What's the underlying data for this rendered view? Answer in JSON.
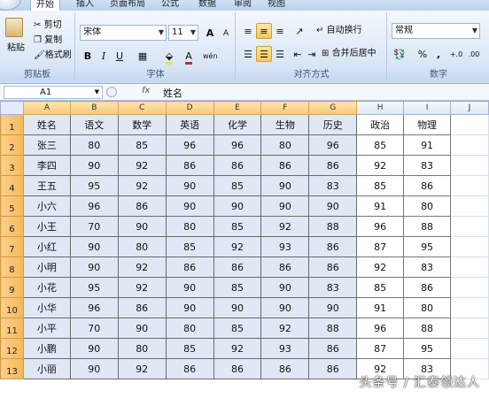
{
  "tabs": [
    "开始",
    "插入",
    "页面布局",
    "公式",
    "数据",
    "审阅",
    "视图"
  ],
  "clipboard": {
    "paste": "粘贴",
    "cut": "剪切",
    "copy": "复制",
    "format_painter": "格式刷",
    "label": "剪贴板"
  },
  "font": {
    "name": "宋体",
    "size": "11",
    "grow": "A",
    "shrink": "A",
    "label": "字体",
    "bold": "B",
    "italic": "I",
    "underline": "U",
    "phonetic": "wén"
  },
  "alignment": {
    "wrap": "自动换行",
    "merge": "合并后居中",
    "label": "对齐方式"
  },
  "number": {
    "format": "常规",
    "percent": "%",
    "comma": ",",
    "label": "数字"
  },
  "formula_bar": {
    "name_box": "A1",
    "fx": "fx",
    "value": "姓名"
  },
  "columns": [
    "A",
    "B",
    "C",
    "D",
    "E",
    "F",
    "G",
    "H",
    "I",
    "J"
  ],
  "rows": [
    [
      "姓名",
      "语文",
      "数学",
      "英语",
      "化学",
      "生物",
      "历史",
      "政治",
      "物理"
    ],
    [
      "张三",
      "80",
      "85",
      "96",
      "96",
      "80",
      "96",
      "85",
      "91"
    ],
    [
      "李四",
      "90",
      "92",
      "86",
      "86",
      "86",
      "86",
      "92",
      "83"
    ],
    [
      "王五",
      "95",
      "92",
      "90",
      "85",
      "90",
      "83",
      "85",
      "86"
    ],
    [
      "小六",
      "96",
      "86",
      "90",
      "90",
      "90",
      "90",
      "91",
      "80"
    ],
    [
      "小王",
      "70",
      "90",
      "80",
      "85",
      "92",
      "88",
      "96",
      "88"
    ],
    [
      "小红",
      "90",
      "80",
      "85",
      "92",
      "93",
      "86",
      "87",
      "95"
    ],
    [
      "小明",
      "90",
      "92",
      "86",
      "86",
      "86",
      "86",
      "92",
      "83"
    ],
    [
      "小花",
      "95",
      "92",
      "90",
      "85",
      "90",
      "83",
      "85",
      "86"
    ],
    [
      "小华",
      "96",
      "86",
      "90",
      "90",
      "90",
      "90",
      "91",
      "80"
    ],
    [
      "小平",
      "70",
      "90",
      "80",
      "85",
      "92",
      "88",
      "96",
      "88"
    ],
    [
      "小鹏",
      "90",
      "80",
      "85",
      "92",
      "93",
      "86",
      "87",
      "95"
    ],
    [
      "小丽",
      "90",
      "92",
      "86",
      "86",
      "86",
      "86",
      "92",
      "83"
    ]
  ],
  "watermark": "头条号 / 汇泰领达人"
}
